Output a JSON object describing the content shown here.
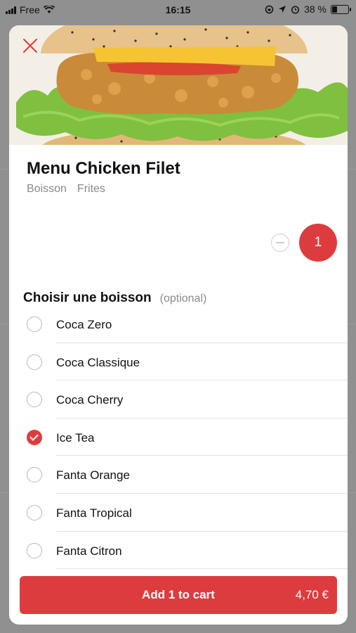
{
  "status_bar": {
    "carrier": "Free",
    "time": "16:15",
    "battery_percent": "38 %",
    "battery_level": 0.38
  },
  "modal": {
    "close_icon": "close-x-icon",
    "product": {
      "title": "Menu Chicken Filet",
      "tags": [
        "Boisson",
        "Frites"
      ]
    },
    "quantity": "1",
    "section": {
      "title": "Choisir une boisson",
      "optional": "(optional)"
    },
    "options": [
      {
        "label": "Coca Zero",
        "checked": false
      },
      {
        "label": "Coca Classique",
        "checked": false
      },
      {
        "label": "Coca Cherry",
        "checked": false
      },
      {
        "label": "Ice Tea",
        "checked": true
      },
      {
        "label": "Fanta Orange",
        "checked": false
      },
      {
        "label": "Fanta Tropical",
        "checked": false
      },
      {
        "label": "Fanta Citron",
        "checked": false
      }
    ],
    "cart_button": {
      "label": "Add 1 to cart",
      "price": "4,70 €"
    }
  },
  "colors": {
    "accent": "#dd3c3f",
    "overlay": "#909090"
  }
}
